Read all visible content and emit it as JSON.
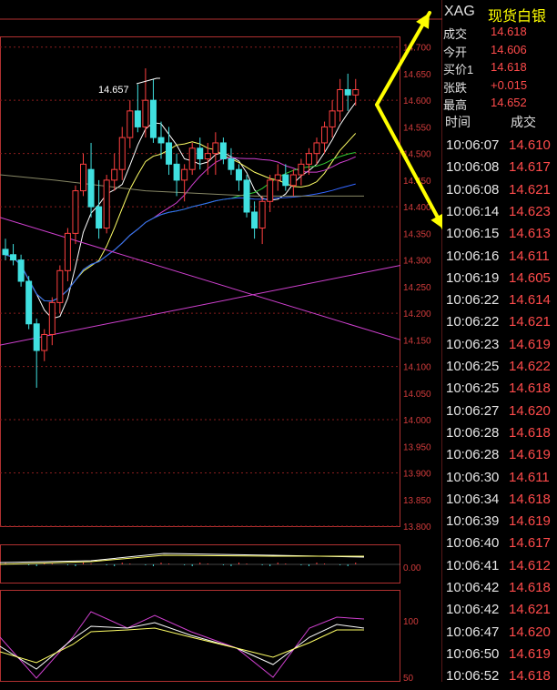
{
  "instrument": {
    "symbol": "XAG",
    "name": "现货白银"
  },
  "quote": [
    {
      "label": "成交",
      "value": "14.618"
    },
    {
      "label": "今开",
      "value": "14.606"
    },
    {
      "label": "买价1",
      "value": "14.618"
    },
    {
      "label": "张跌",
      "value": "+0.015"
    },
    {
      "label": "最高",
      "value": "14.652"
    }
  ],
  "trades_header": {
    "time": "时间",
    "price": "成交"
  },
  "trades": [
    {
      "time": "10:06:07",
      "price": "14.610"
    },
    {
      "time": "10:06:08",
      "price": "14.617"
    },
    {
      "time": "10:06:08",
      "price": "14.621"
    },
    {
      "time": "10:06:14",
      "price": "14.623"
    },
    {
      "time": "10:06:15",
      "price": "14.613"
    },
    {
      "time": "10:06:16",
      "price": "14.611"
    },
    {
      "time": "10:06:19",
      "price": "14.605"
    },
    {
      "time": "10:06:22",
      "price": "14.614"
    },
    {
      "time": "10:06:22",
      "price": "14.621"
    },
    {
      "time": "10:06:23",
      "price": "14.619"
    },
    {
      "time": "10:06:25",
      "price": "14.622"
    },
    {
      "time": "10:06:25",
      "price": "14.618"
    },
    {
      "time": "10:06:27",
      "price": "14.620"
    },
    {
      "time": "10:06:28",
      "price": "14.618"
    },
    {
      "time": "10:06:28",
      "price": "14.619"
    },
    {
      "time": "10:06:30",
      "price": "14.611"
    },
    {
      "time": "10:06:34",
      "price": "14.618"
    },
    {
      "time": "10:06:39",
      "price": "14.619"
    },
    {
      "time": "10:06:40",
      "price": "14.617"
    },
    {
      "time": "10:06:41",
      "price": "14.612"
    },
    {
      "time": "10:06:42",
      "price": "14.618"
    },
    {
      "time": "10:06:42",
      "price": "14.621"
    },
    {
      "time": "10:06:47",
      "price": "14.620"
    },
    {
      "time": "10:06:50",
      "price": "14.619"
    },
    {
      "time": "10:06:52",
      "price": "14.618"
    }
  ],
  "chart_data": {
    "type": "candlestick",
    "price_axis": [
      "14.700",
      "14.650",
      "14.600",
      "14.550",
      "14.500",
      "14.450",
      "14.400",
      "14.350",
      "14.300",
      "14.250",
      "14.200",
      "14.150",
      "14.100",
      "14.050",
      "14.000",
      "13.950",
      "13.900",
      "13.850",
      "13.800"
    ],
    "ylim": [
      13.8,
      14.72
    ],
    "high_label": "14.657",
    "macd_axis": [
      "0.00"
    ],
    "kdj_axis": [
      "100",
      "50"
    ],
    "candles": [
      [
        14.32,
        14.34,
        14.3,
        14.31
      ],
      [
        14.31,
        14.33,
        14.29,
        14.3
      ],
      [
        14.3,
        14.31,
        14.25,
        14.26
      ],
      [
        14.26,
        14.27,
        14.17,
        14.18
      ],
      [
        14.18,
        14.19,
        14.06,
        14.13
      ],
      [
        14.13,
        14.17,
        14.11,
        14.16
      ],
      [
        14.16,
        14.23,
        14.14,
        14.22
      ],
      [
        14.22,
        14.29,
        14.2,
        14.28
      ],
      [
        14.28,
        14.36,
        14.26,
        14.35
      ],
      [
        14.35,
        14.44,
        14.33,
        14.43
      ],
      [
        14.43,
        14.5,
        14.42,
        14.48
      ],
      [
        14.47,
        14.52,
        14.38,
        14.4
      ],
      [
        14.4,
        14.45,
        14.34,
        14.36
      ],
      [
        14.36,
        14.46,
        14.35,
        14.45
      ],
      [
        14.45,
        14.5,
        14.43,
        14.47
      ],
      [
        14.47,
        14.55,
        14.45,
        14.53
      ],
      [
        14.53,
        14.6,
        14.51,
        14.58
      ],
      [
        14.58,
        14.63,
        14.54,
        14.55
      ],
      [
        14.55,
        14.66,
        14.53,
        14.6
      ],
      [
        14.6,
        14.64,
        14.52,
        14.53
      ],
      [
        14.53,
        14.56,
        14.49,
        14.52
      ],
      [
        14.52,
        14.55,
        14.46,
        14.48
      ],
      [
        14.48,
        14.5,
        14.42,
        14.45
      ],
      [
        14.45,
        14.48,
        14.41,
        14.47
      ],
      [
        14.47,
        14.52,
        14.46,
        14.51
      ],
      [
        14.51,
        14.53,
        14.47,
        14.49
      ],
      [
        14.49,
        14.52,
        14.46,
        14.5
      ],
      [
        14.5,
        14.54,
        14.46,
        14.52
      ],
      [
        14.52,
        14.53,
        14.48,
        14.49
      ],
      [
        14.49,
        14.51,
        14.46,
        14.47
      ],
      [
        14.47,
        14.48,
        14.43,
        14.45
      ],
      [
        14.45,
        14.46,
        14.38,
        14.39
      ],
      [
        14.39,
        14.41,
        14.34,
        14.36
      ],
      [
        14.36,
        14.42,
        14.33,
        14.41
      ],
      [
        14.41,
        14.46,
        14.39,
        14.45
      ],
      [
        14.45,
        14.48,
        14.43,
        14.46
      ],
      [
        14.46,
        14.48,
        14.43,
        14.44
      ],
      [
        14.44,
        14.47,
        14.42,
        14.46
      ],
      [
        14.46,
        14.49,
        14.44,
        14.48
      ],
      [
        14.48,
        14.51,
        14.46,
        14.5
      ],
      [
        14.5,
        14.53,
        14.48,
        14.52
      ],
      [
        14.52,
        14.56,
        14.5,
        14.55
      ],
      [
        14.55,
        14.6,
        14.53,
        14.58
      ],
      [
        14.58,
        14.64,
        14.56,
        14.62
      ],
      [
        14.62,
        14.65,
        14.58,
        14.61
      ],
      [
        14.61,
        14.64,
        14.59,
        14.62
      ]
    ]
  }
}
